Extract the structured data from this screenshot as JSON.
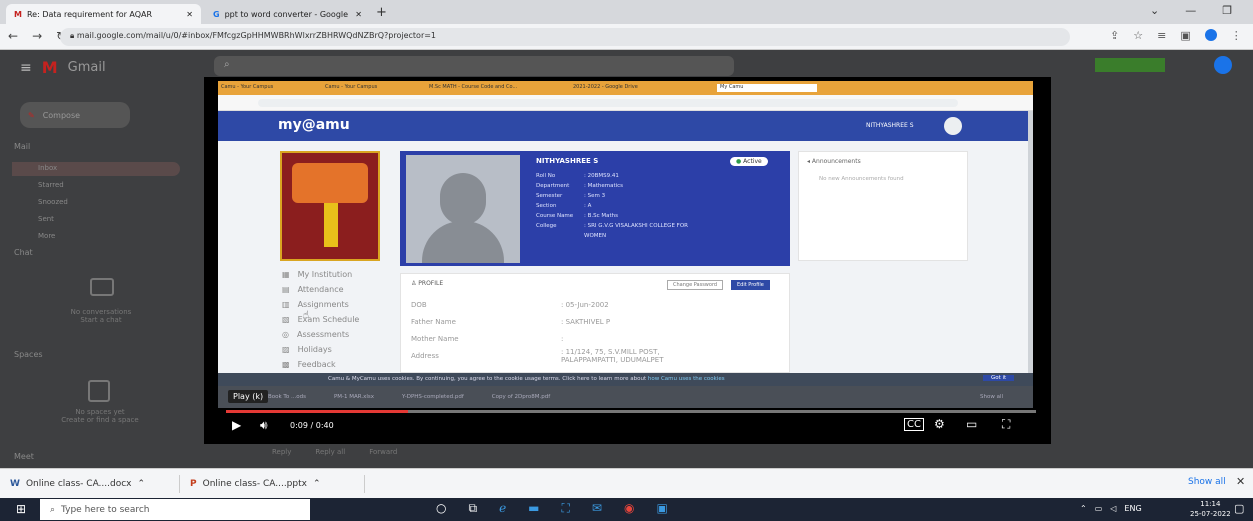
{
  "browser": {
    "tabs": [
      {
        "label": "Re: Data requirement for AQAR"
      },
      {
        "label": "ppt to word converter - Google"
      }
    ],
    "new_tab": "+",
    "url": "mail.google.com/mail/u/0/#inbox/FMfcgzGpHHMWBRhWlxrrZBHRWQdNZBrQ?projector=1"
  },
  "gmail": {
    "logo": "Gmail",
    "compose": "Compose",
    "mail_header": "Mail",
    "labels": [
      "Inbox",
      "Starred",
      "Snoozed",
      "Sent",
      "More"
    ],
    "chat_header": "Chat",
    "chat_empty": "No conversations",
    "chat_link": "Start a chat",
    "spaces_header": "Spaces",
    "spaces_empty": "No spaces yet",
    "spaces_link": "Create or find a space",
    "meet_header": "Meet",
    "reply_actions": [
      "Reply",
      "Reply all",
      "Forward"
    ]
  },
  "inner_browser": {
    "tabs": [
      "Camu - Your Campus",
      "Camu - Your Campus",
      "M.Sc MATH - Course Code and Co...",
      "2021-2022 - Google Drive",
      "My Camu"
    ]
  },
  "mycamu": {
    "logo": "my@amu",
    "user": "NITHYASHREE S",
    "student": {
      "name": "NITHYASHREE S",
      "status": "Active",
      "fields": [
        {
          "label": "Roll No",
          "value": ": 20BMS9.41"
        },
        {
          "label": "Department",
          "value": ": Mathematics"
        },
        {
          "label": "Semester",
          "value": ": Sem 3"
        },
        {
          "label": "Section",
          "value": ": A"
        },
        {
          "label": "Course Name",
          "value": ": B.Sc Maths"
        },
        {
          "label": "College",
          "value": ": SRI G.V.G VISALAKSHI COLLEGE FOR WOMEN"
        }
      ]
    },
    "announcements": {
      "title": "Announcements",
      "empty": "No new Announcements found"
    },
    "nav": [
      "My Institution",
      "Attendance",
      "Assignments",
      "Exam Schedule",
      "Assessments",
      "Holidays",
      "Feedback"
    ],
    "profile": {
      "title": "PROFILE",
      "change_password": "Change Password",
      "edit_profile": "Edit Profile",
      "rows": [
        {
          "label": "DOB",
          "value": ": 05-Jun-2002"
        },
        {
          "label": "Father Name",
          "value": ": SAKTHIVEL P"
        },
        {
          "label": "Mother Name",
          "value": ":"
        },
        {
          "label": "Address",
          "value": ": 11/124, 75, S.V.MILL POST, PALAPPAMPATTI, UDUMALPET"
        }
      ]
    },
    "cookie": {
      "text": "Camu & MyCamu uses cookies. By continuing, you agree to the cookie usage terms. Click here to learn more about",
      "link": "how Camu uses the cookies",
      "button": "Got it"
    },
    "inner_downloads": [
      "Book To ...ods",
      "PM-1 MAR.xlsx",
      "Y-DPHS-completed.pdf",
      "Copy of 2Dpro8M.pdf"
    ],
    "inner_show_all": "Show all"
  },
  "video": {
    "tooltip": "Play (k)",
    "time": "0:09 / 0:40"
  },
  "downloads": {
    "items": [
      "Online class- CA....docx",
      "Online class- CA....pptx"
    ],
    "show_all": "Show all"
  },
  "taskbar": {
    "search": "Type here to search",
    "lang": "ENG",
    "time": "11:14",
    "date": "25-07-2022"
  },
  "colors": {
    "banner": "#2c3fa8",
    "camu_bar": "#2e49a6",
    "gmail_bg": "#3e3f41",
    "accent_red": "#d93025"
  }
}
